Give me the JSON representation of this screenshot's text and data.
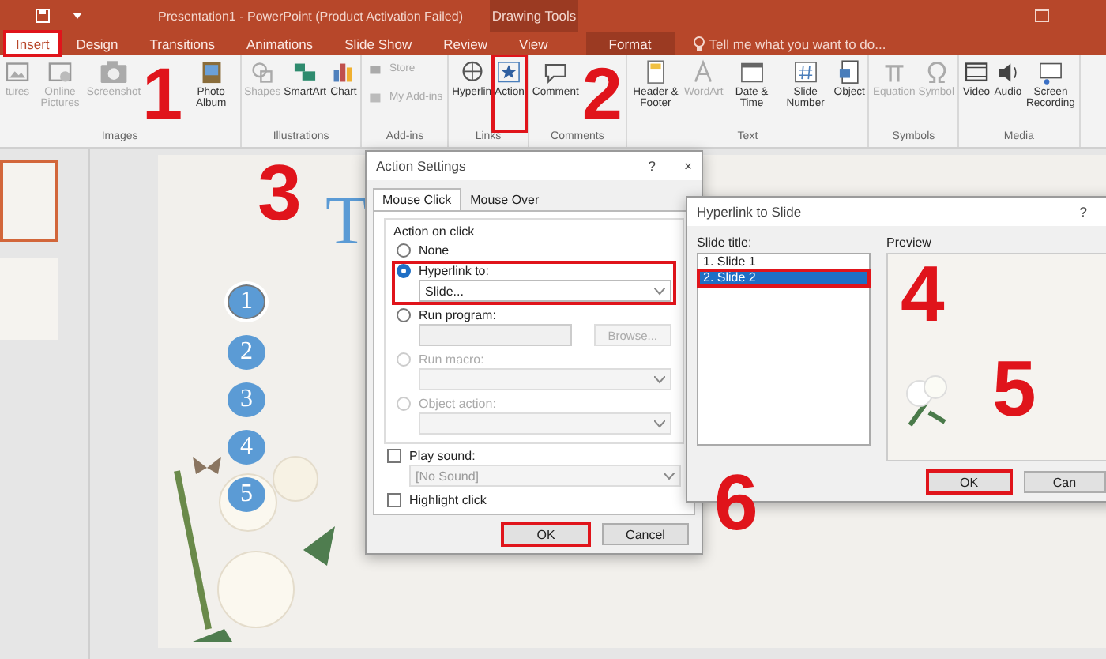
{
  "window": {
    "title": "Presentation1 - PowerPoint (Product Activation Failed)",
    "context_group": "Drawing Tools"
  },
  "tabs": [
    {
      "label": "Insert",
      "selected": true,
      "highlighted": true,
      "kind": "normal"
    },
    {
      "label": "Design",
      "selected": false,
      "highlighted": false,
      "kind": "normal"
    },
    {
      "label": "Transitions",
      "selected": false,
      "highlighted": false,
      "kind": "normal"
    },
    {
      "label": "Animations",
      "selected": false,
      "highlighted": false,
      "kind": "normal"
    },
    {
      "label": "Slide Show",
      "selected": false,
      "highlighted": false,
      "kind": "normal"
    },
    {
      "label": "Review",
      "selected": false,
      "highlighted": false,
      "kind": "normal"
    },
    {
      "label": "View",
      "selected": false,
      "highlighted": false,
      "kind": "normal"
    },
    {
      "label": "Format",
      "selected": false,
      "highlighted": false,
      "kind": "context"
    }
  ],
  "tell_me": {
    "placeholder": "Tell me what you want to do..."
  },
  "ribbon": [
    {
      "label": "Images",
      "buttons": [
        {
          "label": "tures",
          "kind": "large",
          "disabled": true,
          "highlighted": false
        },
        {
          "label": "Online Pictures",
          "kind": "large",
          "disabled": true,
          "highlighted": false
        },
        {
          "label": "Screenshot",
          "kind": "large",
          "disabled": true,
          "highlighted": false
        },
        {
          "label": "Photo Album",
          "kind": "large",
          "disabled": false,
          "highlighted": false
        }
      ]
    },
    {
      "label": "Illustrations",
      "buttons": [
        {
          "label": "Shapes",
          "kind": "large",
          "disabled": true,
          "highlighted": false
        },
        {
          "label": "SmartArt",
          "kind": "large",
          "disabled": false,
          "highlighted": false
        },
        {
          "label": "Chart",
          "kind": "large",
          "disabled": false,
          "highlighted": false
        }
      ]
    },
    {
      "label": "Add-ins",
      "buttons": [
        {
          "label": "Store",
          "kind": "small",
          "disabled": true,
          "highlighted": false
        },
        {
          "label": "My Add-ins",
          "kind": "small",
          "disabled": true,
          "highlighted": false
        }
      ]
    },
    {
      "label": "Links",
      "buttons": [
        {
          "label": "Hyperlin",
          "kind": "large",
          "disabled": false,
          "highlighted": false
        },
        {
          "label": "Action",
          "kind": "large",
          "disabled": false,
          "highlighted": true
        }
      ]
    },
    {
      "label": "Comments",
      "buttons": [
        {
          "label": "Comment",
          "kind": "large",
          "disabled": false,
          "highlighted": false
        }
      ]
    },
    {
      "label": "Text",
      "buttons": [
        {
          "label": "Header & Footer",
          "kind": "large",
          "disabled": false,
          "highlighted": false
        },
        {
          "label": "WordArt",
          "kind": "large",
          "disabled": true,
          "highlighted": false
        },
        {
          "label": "Date & Time",
          "kind": "large",
          "disabled": false,
          "highlighted": false
        },
        {
          "label": "Slide Number",
          "kind": "large",
          "disabled": false,
          "highlighted": false
        },
        {
          "label": "Object",
          "kind": "large",
          "disabled": false,
          "highlighted": false
        }
      ]
    },
    {
      "label": "Symbols",
      "buttons": [
        {
          "label": "Equation",
          "kind": "large",
          "disabled": true,
          "highlighted": false
        },
        {
          "label": "Symbol",
          "kind": "large",
          "disabled": true,
          "highlighted": false
        }
      ]
    },
    {
      "label": "Media",
      "buttons": [
        {
          "label": "Video",
          "kind": "large",
          "disabled": false,
          "highlighted": false
        },
        {
          "label": "Audio",
          "kind": "large",
          "disabled": false,
          "highlighted": false
        },
        {
          "label": "Screen Recording",
          "kind": "large",
          "disabled": false,
          "highlighted": false
        }
      ]
    }
  ],
  "thumbnails": [
    {
      "selected": true
    },
    {
      "selected": false
    }
  ],
  "slide": {
    "title": "T",
    "shapes": [
      {
        "label": "1",
        "selected": true
      },
      {
        "label": "2",
        "selected": false
      },
      {
        "label": "3",
        "selected": false
      },
      {
        "label": "4",
        "selected": false
      },
      {
        "label": "5",
        "selected": false
      }
    ]
  },
  "action_dialog": {
    "title": "Action Settings",
    "help": "?",
    "close": "×",
    "tabs": [
      {
        "label": "Mouse Click",
        "selected": true
      },
      {
        "label": "Mouse Over",
        "selected": false
      }
    ],
    "group_label": "Action on click",
    "options": [
      {
        "label": "None",
        "selected": false,
        "disabled": false,
        "highlighted": false
      },
      {
        "label": "Hyperlink to:",
        "selected": true,
        "disabled": false,
        "highlighted": true,
        "control": {
          "kind": "dropdown",
          "value": "Slide...",
          "disabled": false
        }
      },
      {
        "label": "Run program:",
        "selected": false,
        "disabled": false,
        "highlighted": false,
        "control": {
          "kind": "field",
          "button": "Browse...",
          "disabled": true
        }
      },
      {
        "label": "Run macro:",
        "selected": false,
        "disabled": true,
        "highlighted": false,
        "control": {
          "kind": "dropdown",
          "disabled": true
        }
      },
      {
        "label": "Object action:",
        "selected": false,
        "disabled": true,
        "highlighted": false,
        "control": {
          "kind": "dropdown",
          "disabled": true
        }
      }
    ],
    "checks": [
      {
        "label": "Play sound:",
        "checked": false,
        "control": {
          "kind": "dropdown",
          "value": "[No Sound]",
          "disabled": true
        }
      },
      {
        "label": "Highlight click",
        "checked": false
      }
    ],
    "buttons": [
      {
        "label": "OK",
        "highlighted": true
      },
      {
        "label": "Cancel",
        "highlighted": false
      }
    ]
  },
  "hyperlink_dialog": {
    "title": "Hyperlink to Slide",
    "help": "?",
    "list_label": "Slide title:",
    "slides": [
      {
        "label": "1. Slide 1",
        "selected": false,
        "highlighted": false
      },
      {
        "label": "2. Slide 2",
        "selected": true,
        "highlighted": true
      }
    ],
    "preview_label": "Preview",
    "buttons": [
      {
        "label": "OK",
        "highlighted": true
      },
      {
        "label": "Can",
        "highlighted": false
      }
    ]
  },
  "steps": [
    {
      "label": "1"
    },
    {
      "label": "2"
    },
    {
      "label": "3"
    },
    {
      "label": "4"
    },
    {
      "label": "5"
    },
    {
      "label": "6"
    }
  ]
}
